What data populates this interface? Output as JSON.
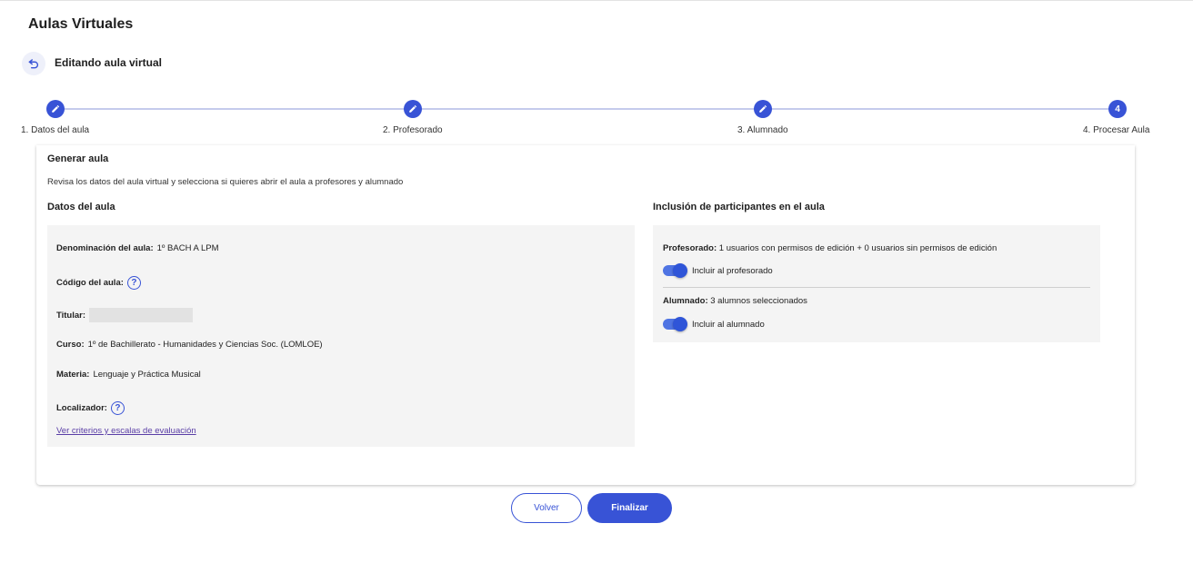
{
  "header": {
    "title": "Aulas Virtuales",
    "subtitle": "Editando aula virtual",
    "back_icon": "undo-arrow-icon"
  },
  "stepper": {
    "steps": [
      {
        "label": "1. Datos del aula",
        "marker": "pencil",
        "completed": true
      },
      {
        "label": "2. Profesorado",
        "marker": "pencil",
        "completed": true
      },
      {
        "label": "3. Alumnado",
        "marker": "pencil",
        "completed": true
      },
      {
        "label": "4. Procesar Aula",
        "marker": "4",
        "completed": false
      }
    ],
    "accent": "#3853d6"
  },
  "main": {
    "title": "Generar aula",
    "description": "Revisa los datos del aula virtual y selecciona si quieres abrir el aula a profesores y alumnado",
    "datos": {
      "title": "Datos del aula",
      "denominacion_label": "Denominación del aula:",
      "denominacion_value": "1º BACH A LPM",
      "codigo_label": "Código del aula:",
      "titular_label": "Titular:",
      "curso_label": "Curso:",
      "curso_value": "1º de Bachillerato - Humanidades y Ciencias Soc. (LOMLOE)",
      "materia_label": "Materia:",
      "materia_value": "Lenguaje y Práctica Musical",
      "localizador_label": "Localizador:",
      "link": "Ver criterios y escalas de evaluación"
    },
    "inclusion": {
      "title": "Inclusión de participantes en el aula",
      "profesorado_label": "Profesorado:",
      "profesorado_value": "1 usuarios con permisos de edición + 0 usuarios sin permisos de edición",
      "toggle_prof_label": "Incluir al profesorado",
      "toggle_prof_on": true,
      "alumnado_label": "Alumnado:",
      "alumnado_value": "3 alumnos seleccionados",
      "toggle_alum_label": "Incluir al alumnado",
      "toggle_alum_on": true
    }
  },
  "footer": {
    "back_label": "Volver",
    "finish_label": "Finalizar"
  }
}
